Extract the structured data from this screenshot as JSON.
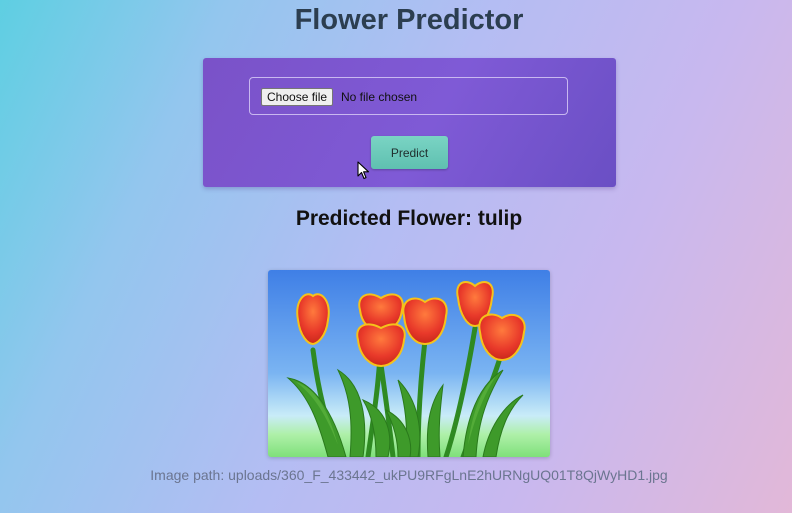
{
  "page": {
    "title": "Flower Predictor"
  },
  "form": {
    "choose_file_label": "Choose file",
    "file_status": "No file chosen",
    "predict_label": "Predict"
  },
  "result": {
    "heading": "Predicted Flower: tulip"
  },
  "image": {
    "path_label": "Image path:",
    "path_value": "uploads/360_F_433442_ukPU9RFgLnE2hURNgUQ01T8QjWyHD1.jpg"
  },
  "colors": {
    "card": "#7a52c8",
    "predict_button": "#6cc9b9",
    "title": "#2c3e50"
  },
  "icons": {
    "cursor": "mouse-pointer-icon"
  }
}
